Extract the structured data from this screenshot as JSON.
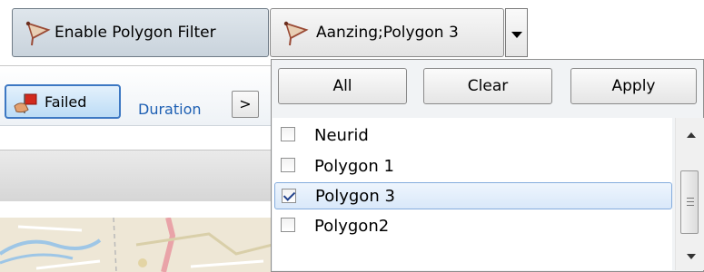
{
  "toolbar": {
    "enable_filter_label": "Enable Polygon Filter",
    "combo_value": "Aanzing;Polygon 3",
    "icon": "polygon-icon"
  },
  "background": {
    "failed_label": "Failed",
    "duration_label": "Duration",
    "nav_label": ">"
  },
  "dropdown": {
    "buttons": {
      "all": "All",
      "clear": "Clear",
      "apply": "Apply"
    },
    "items": [
      {
        "label": "Neurid",
        "checked": false
      },
      {
        "label": "Polygon 1",
        "checked": false
      },
      {
        "label": "Polygon 3",
        "checked": true,
        "selected": true
      },
      {
        "label": "Polygon2",
        "checked": false
      }
    ]
  },
  "colors": {
    "selection_border": "#84acdd",
    "link_blue": "#1d5fb3",
    "failed_border": "#3d78c3"
  }
}
